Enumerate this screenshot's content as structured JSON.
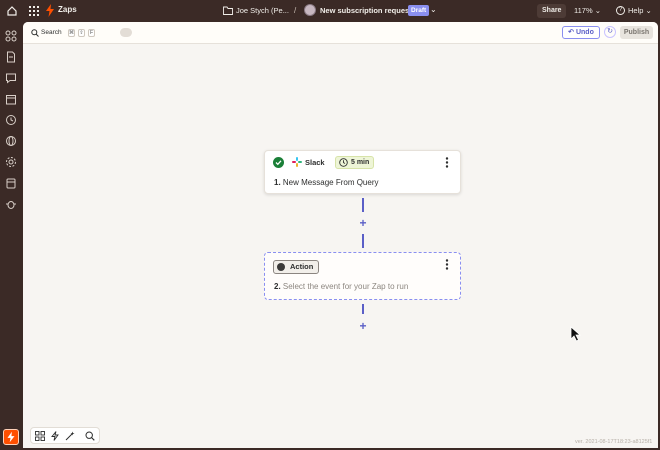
{
  "topbar": {
    "app_title": "Zaps",
    "folder_label": "Joe Stych (Pe...",
    "separator": "/",
    "zap_name": "New subscription request",
    "draft_badge": "Draft",
    "share_label": "Share",
    "zoom_label": "117%",
    "help_label": "Help"
  },
  "left_rail": {
    "icons": [
      "apps-icon",
      "file-icon",
      "chat-icon",
      "calendar-icon",
      "history-icon",
      "globe-icon",
      "settings-icon",
      "archive-icon",
      "bug-icon"
    ]
  },
  "toolbar": {
    "search_label": "Search",
    "shortcut_keys": [
      "⌘",
      "⇧",
      "F"
    ],
    "undo_label": "Undo",
    "publish_label": "Publish"
  },
  "steps": [
    {
      "app_name": "Slack",
      "time_label": "5 min",
      "number": "1.",
      "title": "New Message From Query",
      "status": "complete"
    },
    {
      "chip_label": "Action",
      "number": "2.",
      "title": "Select the event for your Zap to run"
    }
  ],
  "bottom_tools": [
    "apps-icon",
    "bolt-icon",
    "wand-icon",
    "search-icon"
  ],
  "version_text": "ver. 2021-08-17T18:23-a8125f1",
  "colors": {
    "frame": "#3b2a26",
    "canvas": "#f7f5f2",
    "accent": "#5b5fc7",
    "success": "#1a7f37",
    "brand": "#ff4f00"
  }
}
